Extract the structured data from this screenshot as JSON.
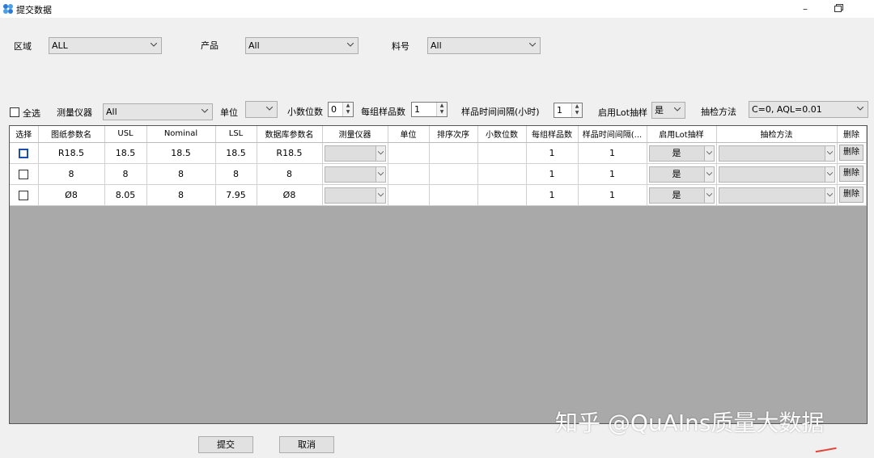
{
  "window": {
    "title": "提交数据",
    "minimize_glyph": "–"
  },
  "filters": {
    "region_label": "区域",
    "region_value": "ALL",
    "product_label": "产品",
    "product_value": "All",
    "part_label": "料号",
    "part_value": "All"
  },
  "options": {
    "select_all_label": "全选",
    "instrument_label": "测量仪器",
    "instrument_value": "All",
    "unit_label": "单位",
    "unit_value": "",
    "decimals_label": "小数位数",
    "decimals_value": "0",
    "samples_label": "每组样品数",
    "samples_value": "1",
    "interval_label": "样品时间间隔(小时)",
    "interval_value": "1",
    "lot_label": "启用Lot抽样",
    "lot_value": "是",
    "method_label": "抽检方法",
    "method_value": "C=0, AQL=0.01"
  },
  "grid": {
    "headers": [
      "选择",
      "图纸参数名",
      "USL",
      "Nominal",
      "LSL",
      "数据库参数名",
      "测量仪器",
      "单位",
      "排序次序",
      "小数位数",
      "每组样品数",
      "样品时间间隔(...",
      "启用Lot抽样",
      "抽检方法",
      "删除"
    ],
    "rows": [
      {
        "drawing_name": "R18.5",
        "usl": "18.5",
        "nominal": "18.5",
        "lsl": "18.5",
        "db_name": "R18.5",
        "instrument": "",
        "unit": "",
        "order": "",
        "decimals": "",
        "samples": "1",
        "interval": "1",
        "lot": "是",
        "method": "",
        "delete": "删除"
      },
      {
        "drawing_name": "8",
        "usl": "8",
        "nominal": "8",
        "lsl": "8",
        "db_name": "8",
        "instrument": "",
        "unit": "",
        "order": "",
        "decimals": "",
        "samples": "1",
        "interval": "1",
        "lot": "是",
        "method": "",
        "delete": "删除"
      },
      {
        "drawing_name": "Ø8",
        "usl": "8.05",
        "nominal": "8",
        "lsl": "7.95",
        "db_name": "Ø8",
        "instrument": "",
        "unit": "",
        "order": "",
        "decimals": "",
        "samples": "1",
        "interval": "1",
        "lot": "是",
        "method": "",
        "delete": "删除"
      }
    ]
  },
  "actions": {
    "submit_label": "提交",
    "cancel_label": "取消"
  },
  "watermark": "知乎 @QuAIns质量大数据",
  "colors": {
    "grid_background": "#a9a9a9",
    "accent": "#1a4fb0",
    "combo_fill": "#e5e5e5"
  },
  "icons": [
    "app-icon",
    "minimize-icon",
    "restore-icon",
    "chevron-down-icon",
    "spin-up-icon",
    "spin-down-icon"
  ]
}
